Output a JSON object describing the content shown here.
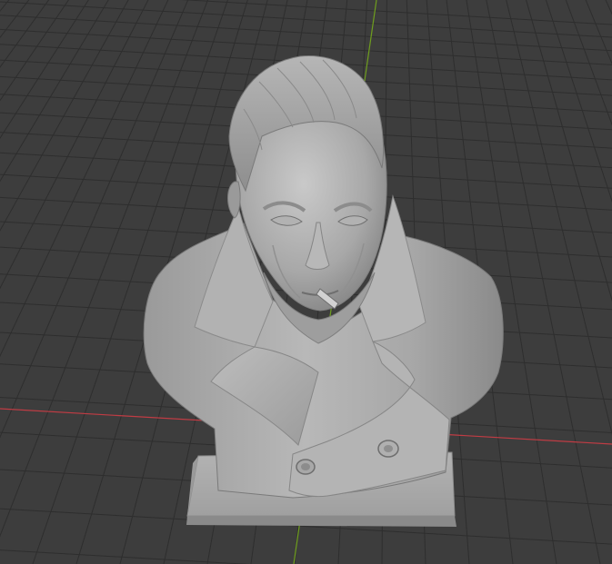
{
  "viewport": {
    "background_color": "#3d3d3d",
    "grid_color": "#2e2e2e",
    "grid_color_fine": "#353535",
    "x_axis_color": "#c03c44",
    "y_axis_color": "#6f9e1e",
    "object_base_color": "#a2a2a2",
    "object_highlight_color": "#cfcfcf",
    "object_shadow_color": "#6a6a6a",
    "object_name": "",
    "grid_visible": true,
    "object_mode_icon": "bust-sculpt-model"
  }
}
